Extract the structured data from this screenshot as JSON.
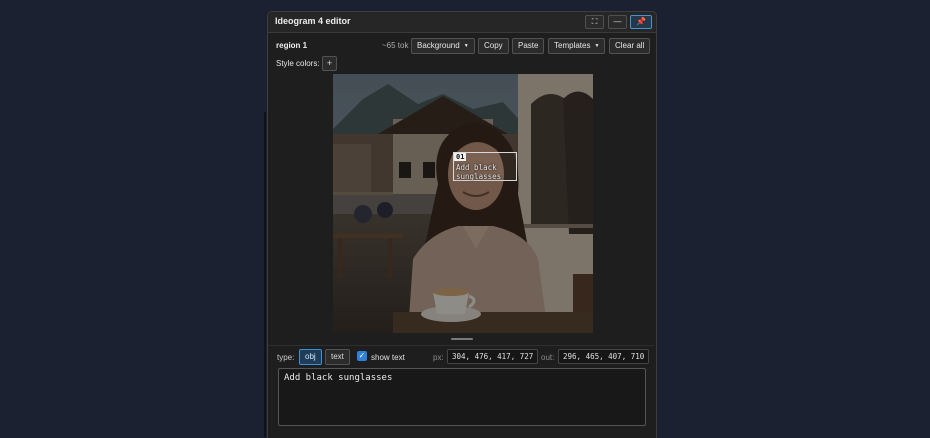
{
  "window": {
    "title": "Ideogram 4 editor",
    "expand_glyph": "⛶",
    "minimize_glyph": "—",
    "pin_glyph": "📌"
  },
  "toolbar": {
    "region_label": "region 1",
    "token_count": "~65 tok",
    "background_label": "Background",
    "copy_label": "Copy",
    "paste_label": "Paste",
    "templates_label": "Templates",
    "clear_all_label": "Clear all",
    "dropdown_caret": "▼"
  },
  "style_colors": {
    "label": "Style colors:",
    "add_label": "+"
  },
  "region": {
    "number": "01",
    "text": "Add black sunglasses"
  },
  "options": {
    "type_label": "type:",
    "type_options": [
      "obj",
      "text"
    ],
    "selected_type": "obj",
    "show_text_label": "show text",
    "show_text_checked": true,
    "px_label": "px:",
    "px_value": "304, 476, 417, 727",
    "out_label": "out:",
    "out_value": "296, 465, 407, 710"
  },
  "prompt_text": "Add black sunglasses",
  "colors": {
    "page_background": "#1b2130",
    "panel_background": "#1e1e1e",
    "active_accent": "#3d8fd6",
    "pin_accent": "#4a94cc"
  }
}
